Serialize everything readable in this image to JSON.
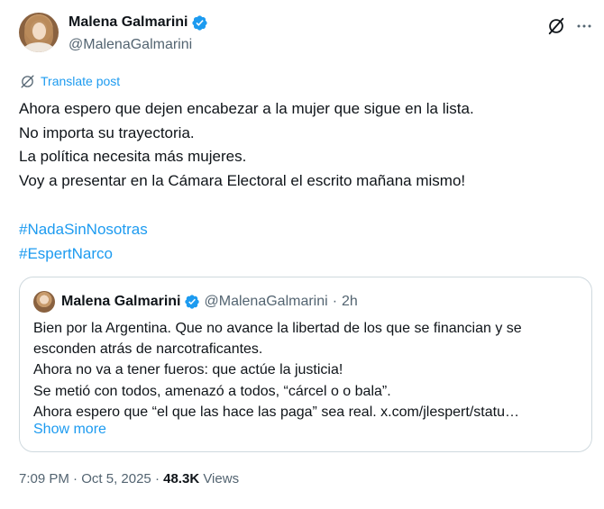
{
  "author": {
    "display_name": "Malena Galmarini",
    "handle": "@MalenaGalmarini",
    "verified": true
  },
  "icons": {
    "verified": "verified-badge-icon",
    "grok": "grok-icon",
    "more": "more-horizontal-icon",
    "translate": "globe-icon"
  },
  "colors": {
    "link": "#1d9bf0",
    "text": "#0f1419",
    "muted": "#536471",
    "border": "#cfd9de"
  },
  "translate_label": "Translate post",
  "body_lines": [
    "Ahora espero que dejen encabezar a la mujer que sigue en la lista.",
    "No importa su trayectoria.",
    "La política necesita más mujeres.",
    "Voy a presentar en la Cámara Electoral el escrito mañana mismo!"
  ],
  "hashtags": [
    "#NadaSinNosotras",
    "#EspertNarco"
  ],
  "quoted_post": {
    "display_name": "Malena Galmarini",
    "handle": "@MalenaGalmarini",
    "separator": "·",
    "time": "2h",
    "lines": [
      "Bien por la Argentina. Que no avance la libertad de los que se financian y se",
      "esconden atrás de narcotraficantes.",
      "Ahora no va a tener fueros: que actúe la justicia!",
      "Se metió con todos, amenazó a todos, “cárcel o o bala”.",
      "Ahora espero que “el que las hace las paga” sea real. x.com/jlespert/statu…"
    ],
    "show_more": "Show more"
  },
  "meta": {
    "time": "7:09 PM",
    "separator": " · ",
    "date": "Oct 5, 2025",
    "views_count": "48.3K",
    "views_label": "Views"
  }
}
